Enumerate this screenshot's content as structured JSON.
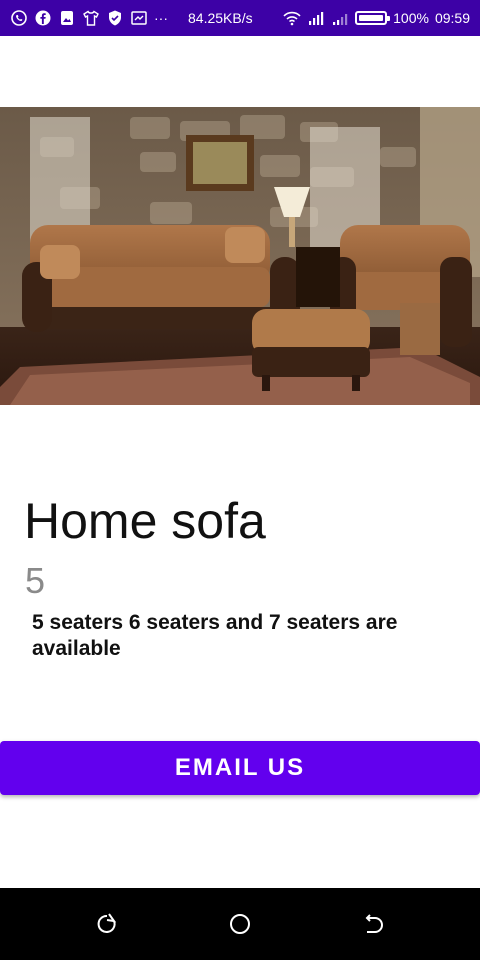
{
  "status_bar": {
    "icons": [
      "whatsapp-icon",
      "facebook-icon",
      "gallery-icon",
      "shirt-icon",
      "shield-icon",
      "cast-icon",
      "more-icon"
    ],
    "more_label": "···",
    "speed": "84.25KB/s",
    "battery_percent": "100%",
    "battery_level": 1.0,
    "time": "09:59"
  },
  "product": {
    "image_icon": "sofa-photo",
    "title": "Home sofa",
    "count": "5",
    "description": "5 seaters 6 seaters and 7 seaters are available"
  },
  "actions": {
    "email_label": "EMAIL US"
  },
  "nav": {
    "icons": [
      "recent-apps-icon",
      "home-icon",
      "back-icon"
    ]
  },
  "colors": {
    "status_bar": "#3d01a6",
    "accent": "#6200ee",
    "nav_bar": "#000000"
  }
}
